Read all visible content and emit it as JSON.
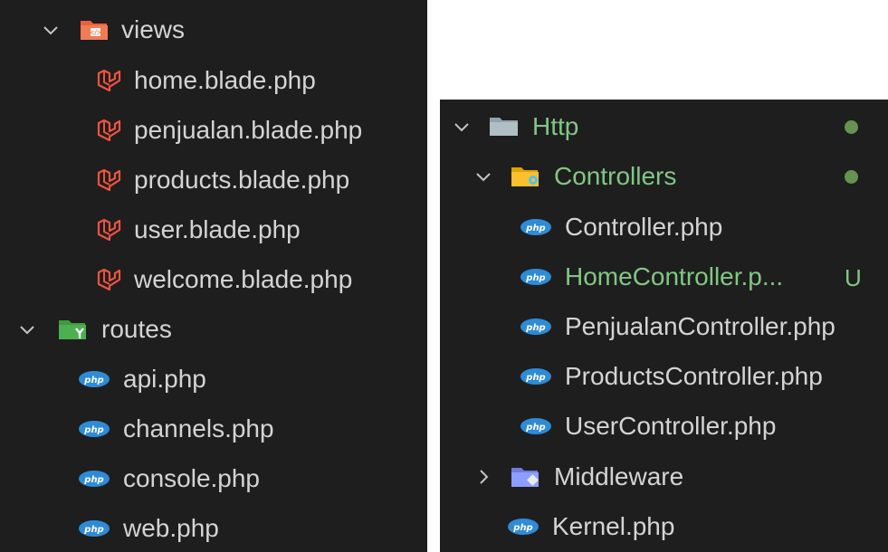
{
  "left_tree": {
    "views_folder": "views",
    "views_files": [
      "home.blade.php",
      "penjualan.blade.php",
      "products.blade.php",
      "user.blade.php",
      "welcome.blade.php"
    ],
    "routes_folder": "routes",
    "routes_files": [
      "api.php",
      "channels.php",
      "console.php",
      "web.php"
    ]
  },
  "right_tree": {
    "http_folder": "Http",
    "controllers_folder": "Controllers",
    "controller_files": [
      {
        "name": "Controller.php",
        "status": ""
      },
      {
        "name": "HomeController.p...",
        "status": "U"
      },
      {
        "name": "PenjualanController.php",
        "status": ""
      },
      {
        "name": "ProductsController.php",
        "status": ""
      },
      {
        "name": "UserController.php",
        "status": ""
      }
    ],
    "middleware_folder": "Middleware",
    "kernel_file": "Kernel.php"
  },
  "colors": {
    "background": "#1e1e1e",
    "text": "#d4d4d4",
    "untracked_green": "#81c784",
    "laravel_red": "#f05340",
    "php_blue": "#2e8bd6"
  },
  "icons": {
    "chevron_expanded": "chevron-down-icon",
    "chevron_collapsed": "chevron-right-icon",
    "views_folder": "views-folder-icon",
    "routes_folder": "routes-folder-icon",
    "http_folder": "folder-icon",
    "controllers_folder": "controllers-folder-icon",
    "middleware_folder": "middleware-folder-icon",
    "blade": "laravel-blade-icon",
    "php": "php-file-icon"
  }
}
